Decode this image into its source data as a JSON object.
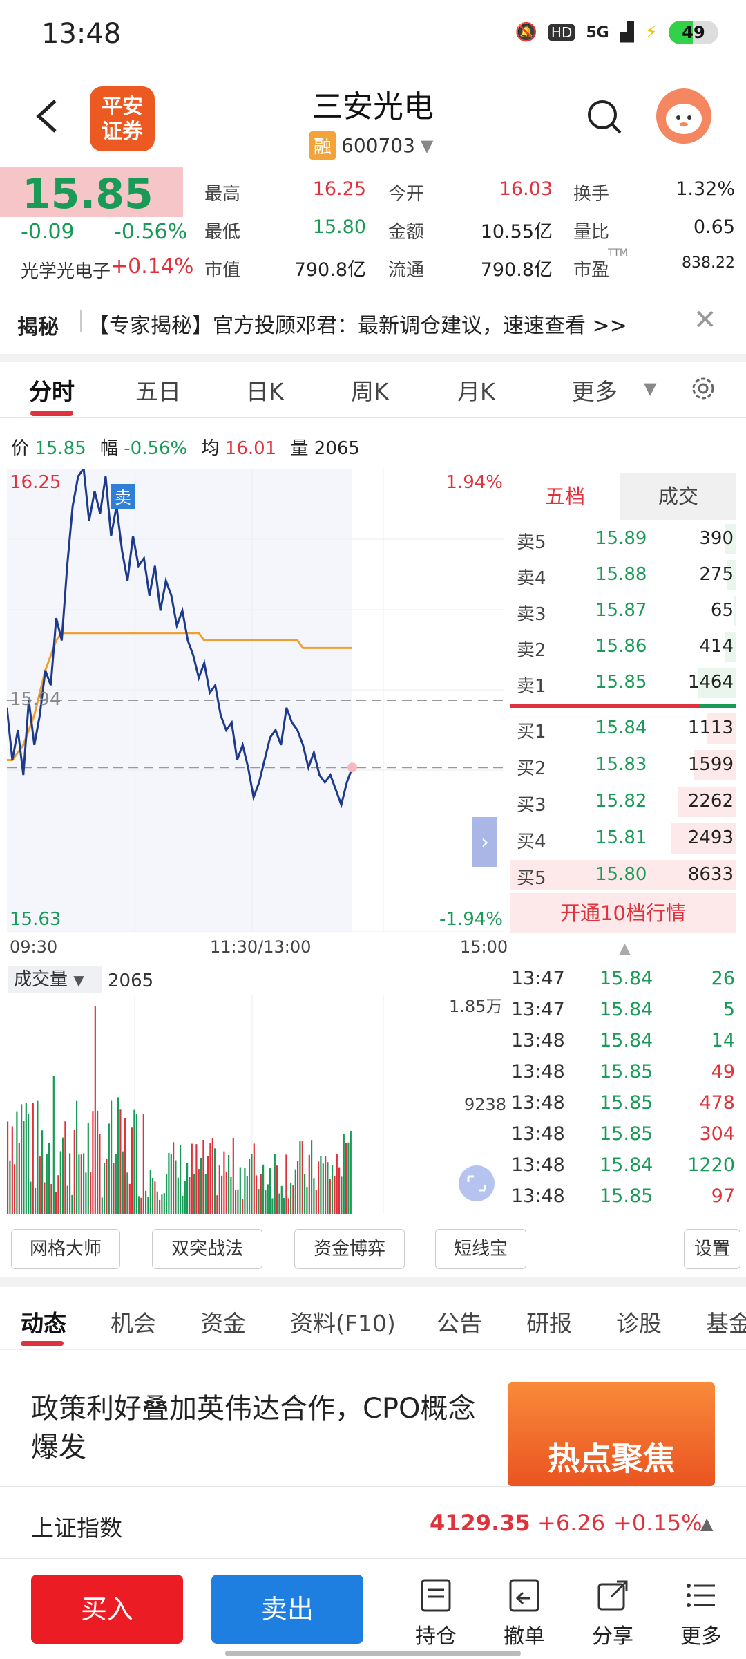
{
  "status": {
    "time": "13:48",
    "network": "5G",
    "battery": "49"
  },
  "header": {
    "logo_line1": "平安",
    "logo_line2": "证券",
    "stock_name": "三安光电",
    "rong": "融",
    "stock_code": "600703"
  },
  "quote": {
    "price": "15.85",
    "change": "-0.09",
    "change_pct": "-0.56%",
    "sector_name": "光学光电子",
    "sector_chg": "+0.14%",
    "rows": [
      [
        {
          "label": "最高",
          "value": "16.25"
        },
        {
          "label": "今开",
          "value": "16.03"
        },
        {
          "label": "换手",
          "value": "1.32%"
        }
      ],
      [
        {
          "label": "最低",
          "value": "15.80"
        },
        {
          "label": "金额",
          "value": "10.55亿"
        },
        {
          "label": "量比",
          "value": "0.65"
        }
      ],
      [
        {
          "label": "市值",
          "value": "790.8亿"
        },
        {
          "label": "流通",
          "value": "790.8亿"
        },
        {
          "label": "市盈",
          "value": "838.22"
        }
      ]
    ],
    "ttm": "TTM"
  },
  "notice": {
    "tag": "揭秘",
    "text": "【专家揭秘】官方投顾邓君：最新调仓建议，速速查看 >>"
  },
  "period_tabs": [
    "分时",
    "五日",
    "日K",
    "周K",
    "月K",
    "更多"
  ],
  "info_line": {
    "price_label": "价",
    "price": "15.85",
    "pct_label": "幅",
    "pct": "-0.56%",
    "avg_label": "均",
    "avg": "16.01",
    "vol_label": "量",
    "vol": "2065"
  },
  "chart": {
    "y_high": "16.25",
    "y_low": "15.63",
    "pct_high": "1.94%",
    "pct_low": "-1.94%",
    "ref_price": "15.94",
    "sell_marker": "卖",
    "x_labels": [
      "09:30",
      "11:30/13:00",
      "15:00"
    ]
  },
  "chart_data": {
    "type": "line",
    "title": "",
    "ylim": [
      15.63,
      16.25
    ],
    "series": [
      {
        "values": [
          15.93,
          15.86,
          15.9,
          15.84,
          15.94,
          15.88,
          15.92,
          15.98,
          15.96,
          16.05,
          16.02,
          16.12,
          16.2,
          16.24,
          16.25,
          16.18,
          16.22,
          16.19,
          16.24,
          16.16,
          16.2,
          16.14,
          16.1,
          16.16,
          16.12,
          16.13,
          16.08,
          16.12,
          16.06,
          16.1,
          16.08,
          16.04,
          16.06,
          16.02,
          16.0,
          15.97,
          15.99,
          15.95,
          15.96,
          15.92,
          15.9,
          15.91,
          15.86,
          15.88,
          15.85,
          15.81,
          15.83,
          15.86,
          15.89,
          15.9,
          15.88,
          15.93,
          15.91,
          15.9,
          15.88,
          15.85,
          15.87,
          15.84,
          15.83,
          15.84,
          15.82,
          15.8,
          15.83,
          15.85
        ]
      },
      {
        "values": [
          15.86,
          15.86,
          15.87,
          15.88,
          15.9,
          15.92,
          15.95,
          15.98,
          16.0,
          16.02,
          16.03,
          16.03,
          16.03,
          16.03,
          16.03,
          16.03,
          16.03,
          16.03,
          16.03,
          16.03,
          16.03,
          16.03,
          16.03,
          16.03,
          16.03,
          16.03,
          16.03,
          16.03,
          16.03,
          16.03,
          16.03,
          16.03,
          16.03,
          16.03,
          16.03,
          16.03,
          16.02,
          16.02,
          16.02,
          16.02,
          16.02,
          16.02,
          16.02,
          16.02,
          16.02,
          16.02,
          16.02,
          16.02,
          16.02,
          16.02,
          16.02,
          16.02,
          16.02,
          16.02,
          16.01,
          16.01,
          16.01,
          16.01,
          16.01,
          16.01,
          16.01,
          16.01,
          16.01,
          16.01
        ]
      }
    ]
  },
  "order_book": {
    "tab_sell": "五档",
    "tab_deal": "成交",
    "asks": [
      {
        "label": "卖5",
        "price": "15.89",
        "vol": "390",
        "bar": 0.05
      },
      {
        "label": "卖4",
        "price": "15.88",
        "vol": "275",
        "bar": 0.04
      },
      {
        "label": "卖3",
        "price": "15.87",
        "vol": "65",
        "bar": 0.01
      },
      {
        "label": "卖2",
        "price": "15.86",
        "vol": "414",
        "bar": 0.05
      },
      {
        "label": "卖1",
        "price": "15.85",
        "vol": "1464",
        "bar": 0.17
      }
    ],
    "bids": [
      {
        "label": "买1",
        "price": "15.84",
        "vol": "1113",
        "bar": 0.13
      },
      {
        "label": "买2",
        "price": "15.83",
        "vol": "1599",
        "bar": 0.19
      },
      {
        "label": "买3",
        "price": "15.82",
        "vol": "2262",
        "bar": 0.26
      },
      {
        "label": "买4",
        "price": "15.81",
        "vol": "2493",
        "bar": 0.29
      },
      {
        "label": "买5",
        "price": "15.80",
        "vol": "8633",
        "bar": 1.0
      }
    ],
    "open10": "开通10档行情"
  },
  "volume": {
    "label": "成交量",
    "value": "2065",
    "max_label": "1.85万",
    "mid_label": "9238"
  },
  "ticks": [
    {
      "time": "13:47",
      "price": "15.84",
      "vol": "26",
      "dir": "down"
    },
    {
      "time": "13:47",
      "price": "15.84",
      "vol": "5",
      "dir": "down"
    },
    {
      "time": "13:48",
      "price": "15.84",
      "vol": "14",
      "dir": "down"
    },
    {
      "time": "13:48",
      "price": "15.85",
      "vol": "49",
      "dir": "up"
    },
    {
      "time": "13:48",
      "price": "15.85",
      "vol": "478",
      "dir": "up"
    },
    {
      "time": "13:48",
      "price": "15.85",
      "vol": "304",
      "dir": "up"
    },
    {
      "time": "13:48",
      "price": "15.84",
      "vol": "1220",
      "dir": "down"
    },
    {
      "time": "13:48",
      "price": "15.85",
      "vol": "97",
      "dir": "up"
    }
  ],
  "tools": [
    "网格大师",
    "双突战法",
    "资金博弈",
    "短线宝",
    "设置"
  ],
  "news_tabs": [
    "动态",
    "机会",
    "资金",
    "资料(F10)",
    "公告",
    "研报",
    "诊股",
    "基金"
  ],
  "news": {
    "title": "政策利好叠加英伟达合作，CPO概念爆发",
    "banner": "热点聚焦"
  },
  "index": {
    "name": "上证指数",
    "value": "4129.35",
    "change": "+6.26",
    "pct": "+0.15%"
  },
  "actions": {
    "buy": "买入",
    "sell": "卖出",
    "hold": "持仓",
    "cancel": "撤单",
    "share": "分享",
    "more": "更多"
  },
  "colors": {
    "up": "#e0323c",
    "down": "#1a9a57",
    "price_line": "#1e3a8a",
    "avg_line": "#f0a030"
  }
}
